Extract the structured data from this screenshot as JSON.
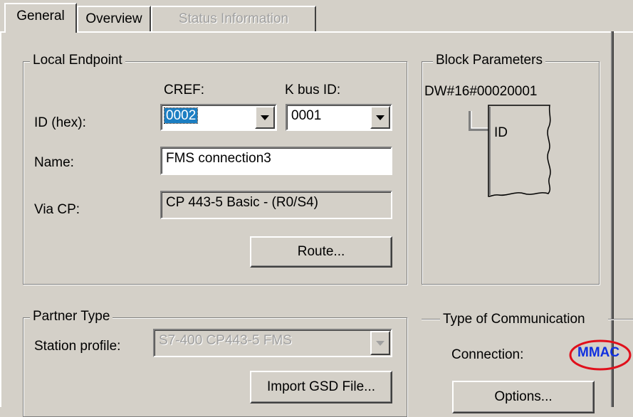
{
  "tabs": [
    {
      "label": "General",
      "active": true,
      "enabled": true
    },
    {
      "label": "Overview",
      "active": false,
      "enabled": true
    },
    {
      "label": "Status Information",
      "active": false,
      "enabled": false
    }
  ],
  "local_endpoint": {
    "title": "Local Endpoint",
    "cref_header": "CREF:",
    "kbus_header": "K bus ID:",
    "id_label": "ID (hex):",
    "cref_value": "0002",
    "kbus_value": "0001",
    "name_label": "Name:",
    "name_value": "FMS connection3",
    "via_cp_label": "Via CP:",
    "via_cp_value": "CP 443-5 Basic - (R0/S4)",
    "route_button": "Route..."
  },
  "block_parameters": {
    "title": "Block Parameters",
    "value": "DW#16#00020001",
    "block_label": "ID"
  },
  "partner_type": {
    "title": "Partner Type",
    "station_profile_label": "Station profile:",
    "station_profile_value": "S7-400 CP443-5 FMS",
    "import_button": "Import GSD File..."
  },
  "type_of_communication": {
    "title": "Type of Communication",
    "connection_label": "Connection:",
    "connection_value": "MMAC",
    "highlight_color": "#e0101c",
    "value_color": "#1030e0",
    "options_button": "Options..."
  },
  "colors": {
    "background": "#d4d0c8",
    "selection": "#1c7ec2",
    "disabled_text": "#a0a0a0"
  }
}
